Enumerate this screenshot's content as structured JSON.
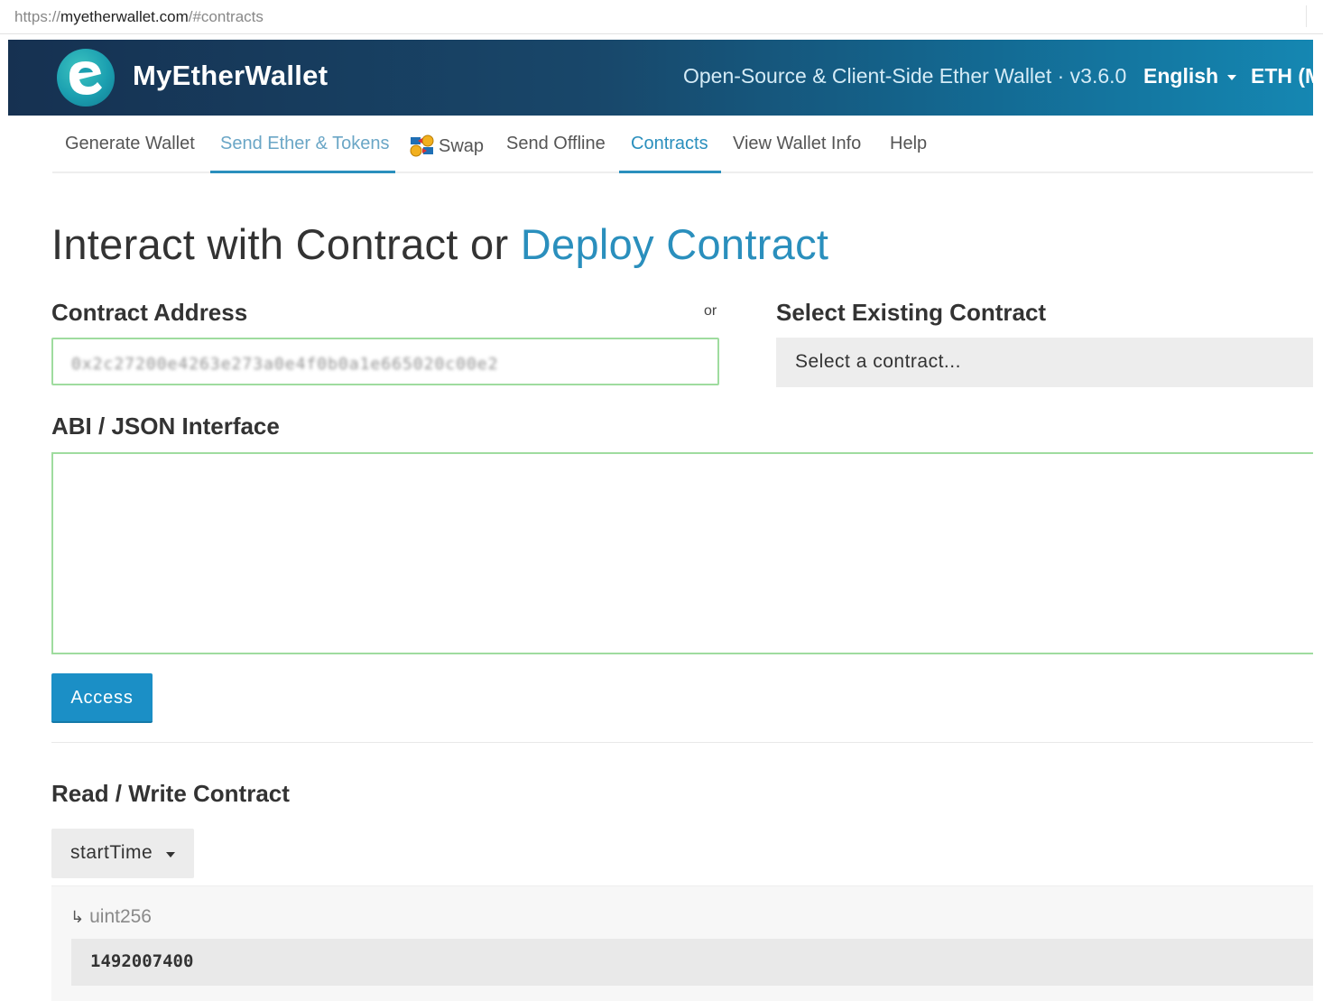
{
  "browser": {
    "url_scheme": "https://",
    "url_host": "myetherwallet.com",
    "url_path": "/#contracts"
  },
  "header": {
    "brand": "MyEtherWallet",
    "tagline": "Open-Source & Client-Side Ether Wallet · v3.6.0",
    "language": "English",
    "network": "ETH (M"
  },
  "nav": {
    "items": [
      {
        "label": "Generate Wallet"
      },
      {
        "label": "Send Ether & Tokens"
      },
      {
        "label": "Swap"
      },
      {
        "label": "Send Offline"
      },
      {
        "label": "Contracts"
      },
      {
        "label": "View Wallet Info"
      },
      {
        "label": "Help"
      }
    ]
  },
  "page": {
    "title_prefix": "Interact with Contract or",
    "title_link": "Deploy Contract"
  },
  "form": {
    "contract_address_label": "Contract Address",
    "or_label": "or",
    "contract_address_value": "0x2c27200e4263e273a0e4f0b0a1e665020c00e2",
    "select_existing_label": "Select Existing Contract",
    "select_placeholder": "Select a contract...",
    "abi_label": "ABI / JSON Interface",
    "abi_value": "",
    "access_button": "Access"
  },
  "read_write": {
    "heading": "Read / Write Contract",
    "selected_function": "startTime",
    "output_arrow": "↳",
    "output_type": "uint256",
    "output_value": "1492007400"
  },
  "colors": {
    "header_gradient_start": "#163151",
    "header_gradient_end": "#1587b2",
    "accent": "#2a8fbd",
    "button": "#1b8fc6",
    "valid_border": "#9fdc9f"
  }
}
